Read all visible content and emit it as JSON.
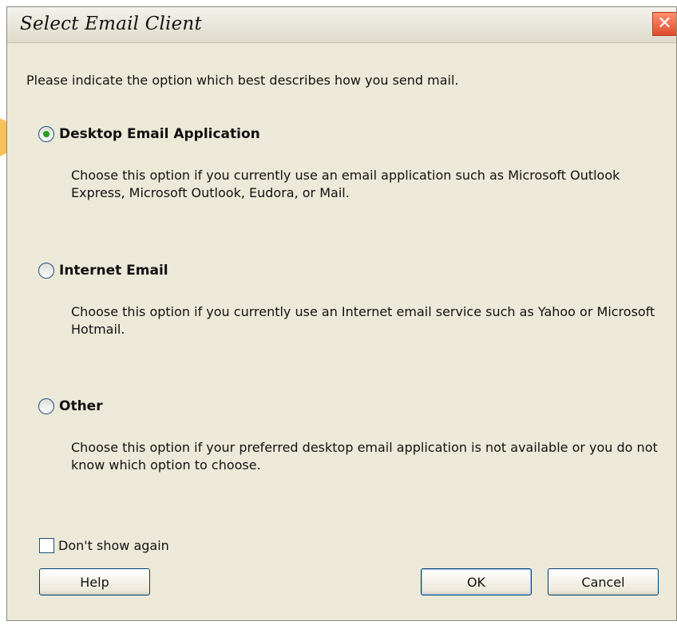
{
  "dialog": {
    "title": "Select Email Client",
    "close_symbol": "✕",
    "intro": "Please indicate the option which best describes how you send mail."
  },
  "options": [
    {
      "label": "Desktop Email Application",
      "selected": true,
      "description": "Choose this option if you currently use an email application such as Microsoft Outlook Express, Microsoft Outlook, Eudora, or Mail."
    },
    {
      "label": "Internet Email",
      "selected": false,
      "description": "Choose this option if you currently use an Internet email service such as Yahoo or Microsoft Hotmail."
    },
    {
      "label": "Other",
      "selected": false,
      "description": "Choose this option if your preferred desktop email application is not available or you do not know which option to choose."
    }
  ],
  "checkbox": {
    "label": "Don't show again",
    "checked": false
  },
  "buttons": {
    "help": "Help",
    "ok": "OK",
    "cancel": "Cancel"
  },
  "colors": {
    "dialog_background": "#ece9d8",
    "highlight_pointer": "#f7c25a",
    "radio_selected_dot": "#21a121",
    "close_button": "#e04d2b"
  },
  "icons": {
    "pointer": "pointer-arrow-icon",
    "close": "close-icon"
  }
}
